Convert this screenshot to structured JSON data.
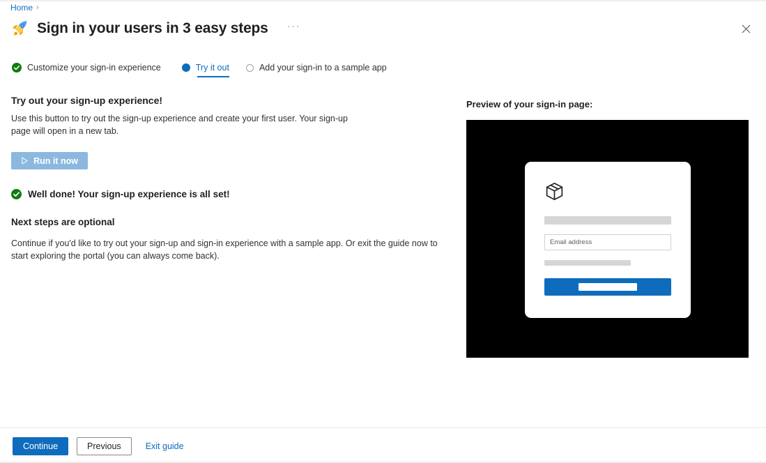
{
  "breadcrumb": {
    "home_label": "Home",
    "chevron": "›"
  },
  "header": {
    "title": "Sign in your users in 3 easy steps",
    "rocket_icon_name": "rocket-icon",
    "more_label": "···",
    "close_icon_name": "close-icon"
  },
  "steps": [
    {
      "label": "Customize your sign-in experience",
      "state": "done"
    },
    {
      "label": "Try it out",
      "state": "current"
    },
    {
      "label": "Add your sign-in to a sample app",
      "state": "pending"
    }
  ],
  "main": {
    "heading": "Try out your sign-up experience!",
    "description": "Use this button to try out the sign-up experience and create your first user. Your sign-up page will open in a new tab.",
    "run_button_label": "Run it now",
    "success_message": "Well done! Your sign-up experience is all set!",
    "next_heading": "Next steps are optional",
    "next_description": "Continue if you'd like to try out your sign-up and sign-in experience with a sample app. Or exit the guide now to start exploring the portal (you can always come back)."
  },
  "preview": {
    "label": "Preview of your sign-in page:",
    "logo_icon_name": "box-logo-icon",
    "email_placeholder": "Email address",
    "background_color": "#000000",
    "cta_color": "#0f6cbd"
  },
  "footer": {
    "continue_label": "Continue",
    "previous_label": "Previous",
    "exit_label": "Exit guide"
  },
  "colors": {
    "accent": "#0f6cbd",
    "success": "#107c10",
    "muted_button": "#8cb8e0"
  }
}
